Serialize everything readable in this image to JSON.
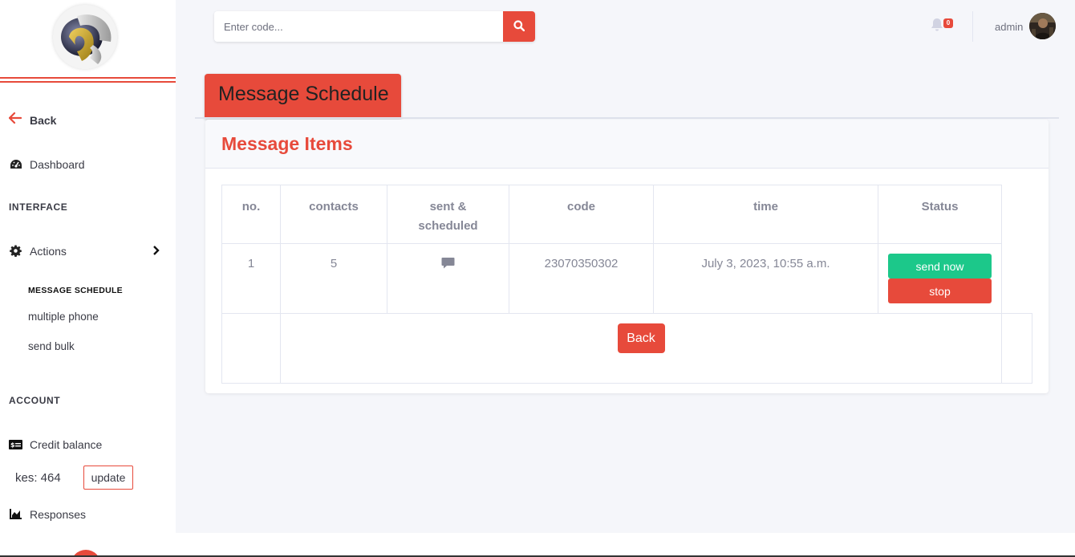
{
  "search": {
    "placeholder": "Enter code..."
  },
  "topbar": {
    "alerts_count": "0",
    "user_name": "admin"
  },
  "sidebar": {
    "back_label": "Back",
    "dashboard_label": "Dashboard",
    "interface_heading": "INTERFACE",
    "actions_label": "Actions",
    "sub_items": [
      "MESSAGE SCHEDULE",
      "multiple phone",
      "send bulk"
    ],
    "account_heading": "ACCOUNT",
    "credit_label": "Credit balance",
    "credit_value": "kes: 464",
    "update_label": "update",
    "responses_label": "Responses"
  },
  "page": {
    "tab_title": "Message Schedule",
    "card_title": "Message Items"
  },
  "table": {
    "headers": [
      "no.",
      "contacts",
      "sent &\nscheduled",
      "code",
      "time",
      "Status"
    ],
    "rows": [
      {
        "no": "1",
        "contacts": "5",
        "sent_icon": "comment-icon",
        "code": "23070350302",
        "time": "July 3, 2023, 10:55 a.m.",
        "send_label": "send now",
        "stop_label": "stop"
      }
    ],
    "back_label": "Back"
  },
  "colors": {
    "accent": "#e74a3b",
    "success": "#1cc88a",
    "text_muted": "#858796"
  }
}
